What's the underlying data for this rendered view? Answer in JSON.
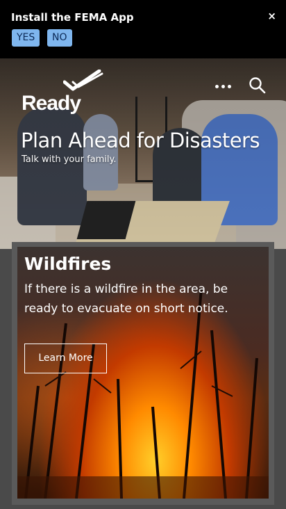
{
  "banner": {
    "title": "Install the FEMA App",
    "yes_label": "YES",
    "no_label": "NO",
    "close_label": "×"
  },
  "header": {
    "logo_text": "Ready",
    "menu_icon": "more-horizontal-icon",
    "search_icon": "search-icon"
  },
  "hero": {
    "title": "Plan Ahead for Disasters",
    "subtitle": "Talk with your family."
  },
  "card": {
    "title": "Wildfires",
    "text": "If there is a wildfire in the area, be ready to evacuate on short notice.",
    "button_label": "Learn More"
  },
  "colors": {
    "banner_bg": "#000000",
    "banner_button": "#7fb6ee",
    "page_bg": "#4a4a4a"
  }
}
